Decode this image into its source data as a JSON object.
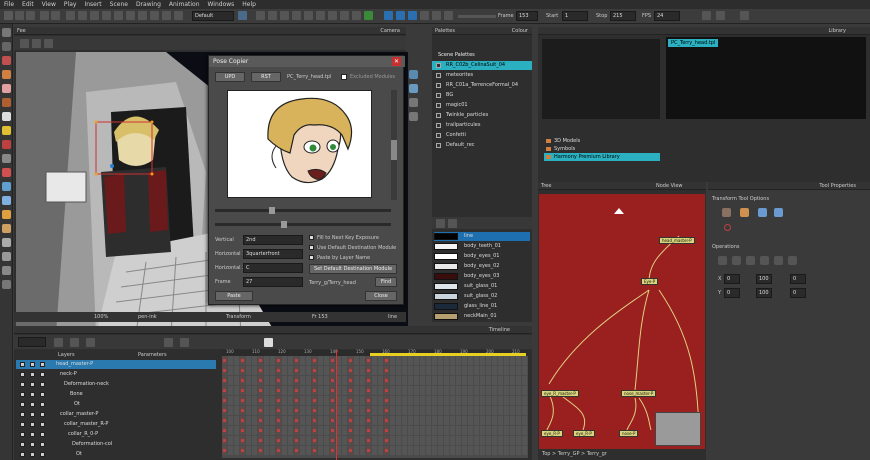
{
  "menu": [
    "File",
    "Edit",
    "View",
    "Play",
    "Insert",
    "Scene",
    "Drawing",
    "Animation",
    "Windows",
    "Help"
  ],
  "toolbar": {
    "workspace": "Default",
    "frame_label": "Frame",
    "frame_value": "153",
    "start_label": "Start",
    "start_value": "1",
    "stop_label": "Stop",
    "stop_value": "215",
    "fps_label": "FPS",
    "fps_value": "24"
  },
  "camera": {
    "tab": "Fee",
    "title": "Camera",
    "zoom": "100%",
    "drawing": "pen-ink",
    "status": "Transform",
    "frame": "Fr 153",
    "mode": "line"
  },
  "pose_copier": {
    "title": "Pose Copier",
    "upd": "UPD",
    "rst": "RST",
    "file": "PC_Terry_head.tpl",
    "excluded": "Excluded Modules",
    "vertical_label": "Vertical",
    "vertical_value": "2nd",
    "horizontal1_label": "Horizontal 1",
    "horizontal1_value": "3quarterfront",
    "horizontal2_label": "Horizontal 2",
    "horizontal2_value": "C",
    "frame_label": "Frame",
    "frame_value": "27",
    "opt1": "Fill to Next Key Exposure",
    "opt2": "Use Default Destination Module",
    "opt3": "Paste by Layer Name",
    "set_default": "Set Default Destination Module",
    "target": "Terry_g/Terry_head",
    "find": "Find",
    "paste": "Paste",
    "close": "Close"
  },
  "colour": {
    "tab": "Palettes",
    "title": "Colour",
    "header": "Scene Palettes",
    "palettes": [
      "RR_C02b_CelinaSuit_04",
      "meteorites",
      "RR_C01a_TerrenceFormal_04",
      "BG",
      "magic01",
      "Twinkle_particles",
      "trailparticules",
      "Confetti",
      "Default_rec"
    ],
    "swatches": [
      {
        "name": "line",
        "color": "#000000"
      },
      {
        "name": "body_teeth_01",
        "color": "#f4f4f4"
      },
      {
        "name": "body_eyes_01",
        "color": "#ffffff"
      },
      {
        "name": "body_eyes_02",
        "color": "#e8e8e8"
      },
      {
        "name": "body_eyes_03",
        "color": "#3a0d0d"
      },
      {
        "name": "suit_glass_01",
        "color": "#dde4ea"
      },
      {
        "name": "suit_glass_02",
        "color": "#c9d3dc"
      },
      {
        "name": "glass_line_01",
        "color": "#1a2a3a"
      },
      {
        "name": "neckMain_01",
        "color": "#b7a070"
      }
    ]
  },
  "library": {
    "title": "Library",
    "template": "PC_Terry_head.tpl",
    "items": [
      "3D Models",
      "Symbols",
      "Harmony Premium Library"
    ]
  },
  "nodeview": {
    "tab": "Tree",
    "title": "Node View",
    "breadcrumb": "Top > Terry_GP > Terry_gr",
    "nodes": [
      "head_master-P",
      "Eye-P",
      "eye_R_master-P",
      "nose_master-P",
      "eye_R-P",
      "eye_R-P",
      "nose-P"
    ]
  },
  "toolprops": {
    "title": "Tool Properties",
    "section1": "Transform Tool Options",
    "section2": "Operations",
    "x": "0",
    "y": "0",
    "sx": "100",
    "sy": "100",
    "rot": "0",
    "skew": "0"
  },
  "timeline": {
    "title": "Timeline",
    "layers_header": "Layers",
    "params_header": "Parameters",
    "layers": [
      "head_master-P",
      "neck-P",
      "Deformation-neck",
      "Bone",
      "Ot",
      "collar_master-P",
      "collar_master_R-P",
      "collar_R_0-P",
      "Deformation-col",
      "Ot"
    ],
    "frames": [
      "100",
      "110",
      "120",
      "130",
      "140",
      "150",
      "160",
      "170",
      "180",
      "190",
      "200",
      "210"
    ]
  }
}
